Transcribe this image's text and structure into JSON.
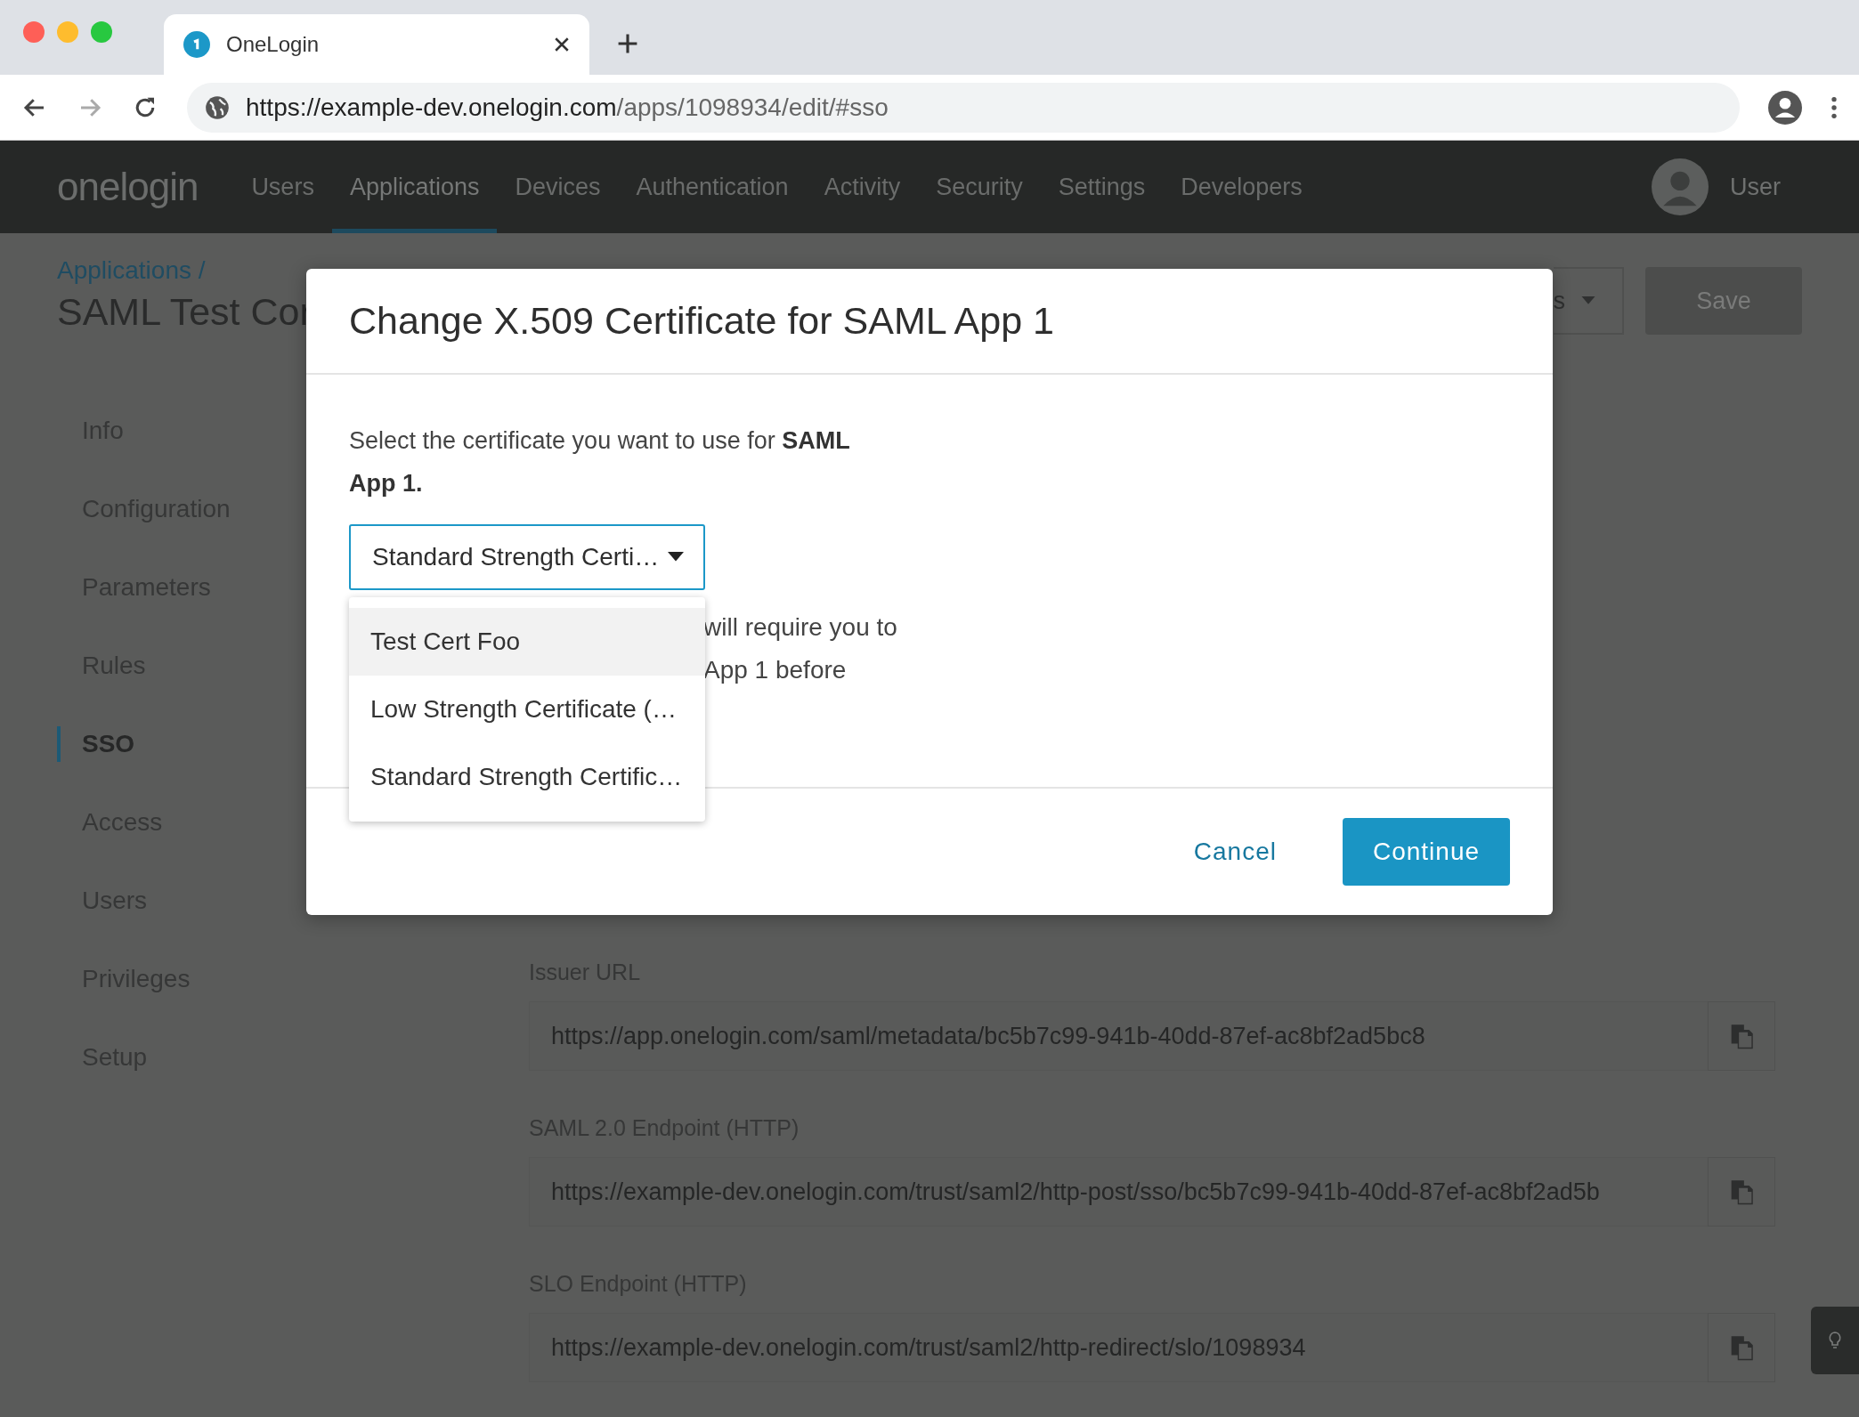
{
  "browser": {
    "tab_title": "OneLogin",
    "url_host": "https://example-dev.onelogin.com",
    "url_path": "/apps/1098934/edit/#sso"
  },
  "header": {
    "logo": "onelogin",
    "nav": [
      {
        "label": "Users",
        "selected": false
      },
      {
        "label": "Applications",
        "selected": true
      },
      {
        "label": "Devices",
        "selected": false
      },
      {
        "label": "Authentication",
        "selected": false
      },
      {
        "label": "Activity",
        "selected": false
      },
      {
        "label": "Security",
        "selected": false
      },
      {
        "label": "Settings",
        "selected": false
      },
      {
        "label": "Developers",
        "selected": false
      }
    ],
    "user": "User"
  },
  "page": {
    "breadcrumb": "Applications /",
    "title": "SAML Test Cor",
    "more_button": "s",
    "save_button": "Save"
  },
  "sidebar": [
    {
      "label": "Info",
      "selected": false
    },
    {
      "label": "Configuration",
      "selected": false
    },
    {
      "label": "Parameters",
      "selected": false
    },
    {
      "label": "Rules",
      "selected": false
    },
    {
      "label": "SSO",
      "selected": true
    },
    {
      "label": "Access",
      "selected": false
    },
    {
      "label": "Users",
      "selected": false
    },
    {
      "label": "Privileges",
      "selected": false
    },
    {
      "label": "Setup",
      "selected": false
    }
  ],
  "fields": [
    {
      "label": "Issuer URL",
      "value": "https://app.onelogin.com/saml/metadata/bc5b7c99-941b-40dd-87ef-ac8bf2ad5bc8"
    },
    {
      "label": "SAML 2.0 Endpoint (HTTP)",
      "value": "https://example-dev.onelogin.com/trust/saml2/http-post/sso/bc5b7c99-941b-40dd-87ef-ac8bf2ad5b"
    },
    {
      "label": "SLO Endpoint (HTTP)",
      "value": "https://example-dev.onelogin.com/trust/saml2/http-redirect/slo/1098934"
    }
  ],
  "modal": {
    "title": "Change X.509 Certificate for SAML App 1",
    "intro": "Select the certificate you want to use for **SAML App 1.**",
    "select": {
      "value": "Standard Strength Certi…",
      "expanded": true
    },
    "options": [
      {
        "label": "Test Cert Foo",
        "highlighted": true
      },
      {
        "label": "Low Strength Certificate (…",
        "highlighted": false
      },
      {
        "label": "Standard Strength Certific…",
        "highlighted": false
      }
    ],
    "note_lines": [
      "will require you to",
      "App 1 before"
    ],
    "cancel": "Cancel",
    "continue": "Continue"
  }
}
